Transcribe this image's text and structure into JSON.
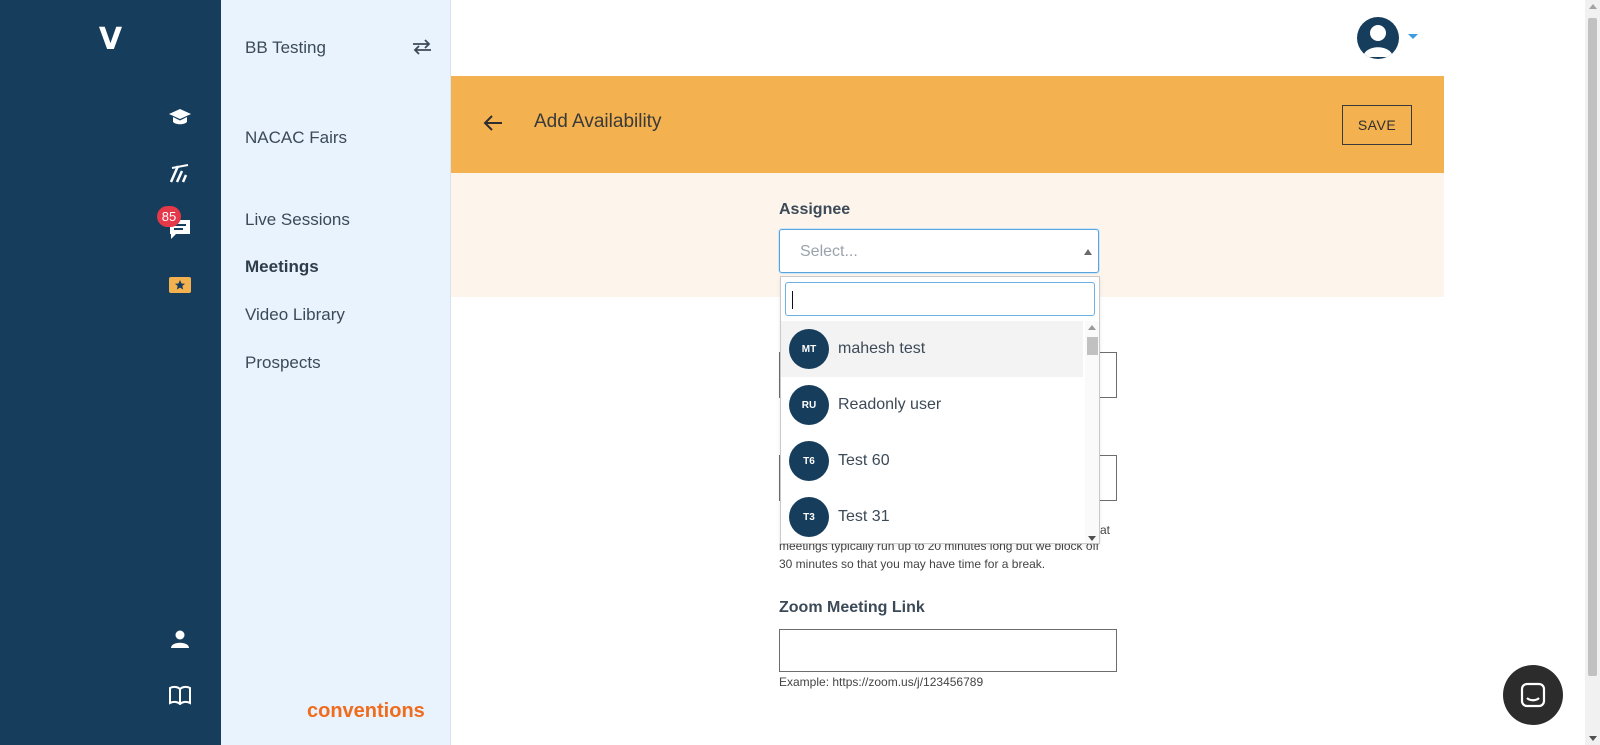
{
  "rail": {
    "logo": "V",
    "badge_count": "85",
    "icons": [
      "graduation-cap-icon",
      "fairs-icon",
      "chat-icon",
      "ticket-icon",
      "person-icon",
      "book-icon"
    ],
    "bg_color": "#173d5c"
  },
  "nav": {
    "org_name": "BB Testing",
    "items": [
      {
        "label": "NACAC Fairs",
        "active": false
      },
      {
        "label": "Live Sessions",
        "active": false
      },
      {
        "label": "Meetings",
        "active": true
      },
      {
        "label": "Video Library",
        "active": false
      },
      {
        "label": "Prospects",
        "active": false
      }
    ],
    "brand": "conventions"
  },
  "header": {
    "title": "Add Availability",
    "save_label": "SAVE",
    "accent": "#f3b14f"
  },
  "form": {
    "assignee_label": "Assignee",
    "assignee_placeholder": "Select...",
    "duration_help": "meetings typically run up to 20 minutes long but we block off 30 minutes so that you may have time for a break.",
    "duration_help_lines": [
      "meetings typically run up to 20 minutes long but we block off",
      "30 minutes so that you may have time for a break."
    ],
    "duration_help_tail": "at",
    "zoom_label": "Zoom Meeting Link",
    "zoom_help": "Example: https://zoom.us/j/123456789"
  },
  "dropdown": {
    "search_value": "",
    "options": [
      {
        "initials": "MT",
        "name": "mahesh test",
        "highlighted": true
      },
      {
        "initials": "RU",
        "name": "Readonly user",
        "highlighted": false
      },
      {
        "initials": "T6",
        "name": "Test 60",
        "highlighted": false
      },
      {
        "initials": "T3",
        "name": "Test 31",
        "highlighted": false
      }
    ]
  }
}
